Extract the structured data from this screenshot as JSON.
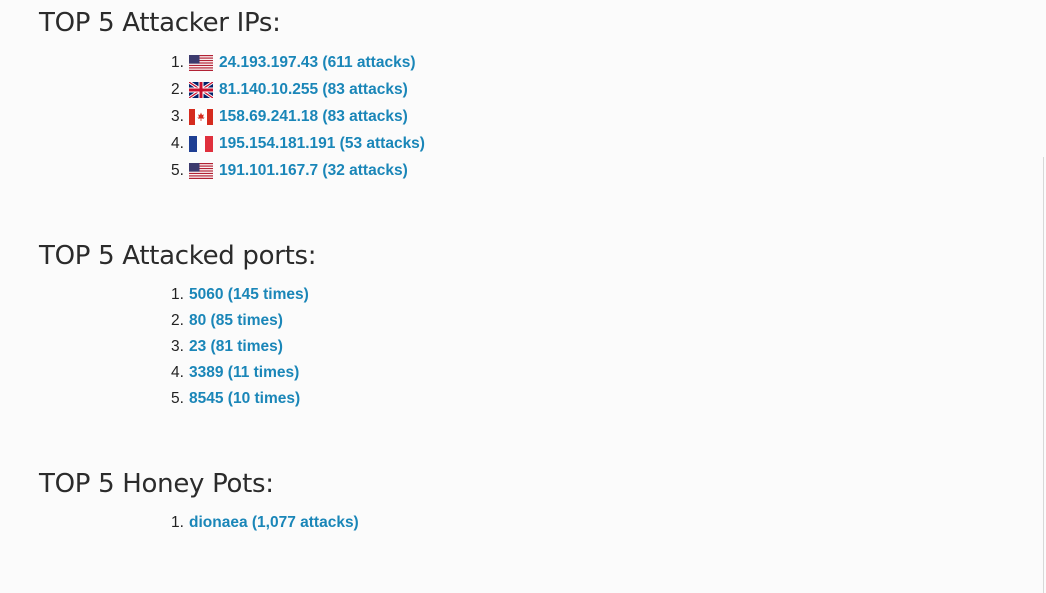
{
  "sections": {
    "ips": {
      "title": "TOP 5 Attacker IPs:",
      "items": [
        {
          "num": "1.",
          "flag": "us-flag-icon",
          "label": "24.193.197.43 (611 attacks)"
        },
        {
          "num": "2.",
          "flag": "uk-flag-icon",
          "label": "81.140.10.255 (83 attacks)"
        },
        {
          "num": "3.",
          "flag": "ca-flag-icon",
          "label": "158.69.241.18 (83 attacks)"
        },
        {
          "num": "4.",
          "flag": "fr-flag-icon",
          "label": "195.154.181.191 (53 attacks)"
        },
        {
          "num": "5.",
          "flag": "us-flag-icon",
          "label": "191.101.167.7 (32 attacks)"
        }
      ]
    },
    "ports": {
      "title": "TOP 5 Attacked ports:",
      "items": [
        {
          "num": "1.",
          "label": "5060 (145 times)"
        },
        {
          "num": "2.",
          "label": "80 (85 times)"
        },
        {
          "num": "3.",
          "label": "23 (81 times)"
        },
        {
          "num": "4.",
          "label": "3389 (11 times)"
        },
        {
          "num": "5.",
          "label": "8545 (10 times)"
        }
      ]
    },
    "pots": {
      "title": "TOP 5 Honey Pots:",
      "items": [
        {
          "num": "1.",
          "label": "dionaea (1,077 attacks)"
        }
      ]
    }
  },
  "colors": {
    "link": "#1a86b8",
    "heading": "#2b2b2b",
    "background": "#fbfbfb"
  }
}
